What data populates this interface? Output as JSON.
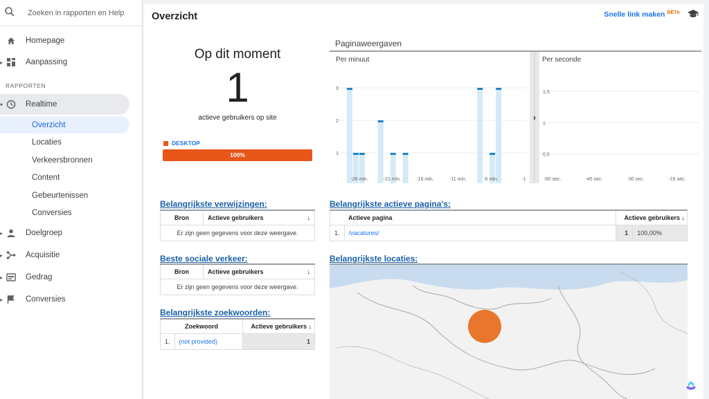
{
  "search": {
    "placeholder": "Zoeken in rapporten en Help"
  },
  "nav": {
    "home": "Homepage",
    "customization": "Aanpassing",
    "section": "RAPPORTEN",
    "realtime": "Realtime",
    "realtime_sub": [
      "Overzicht",
      "Locaties",
      "Verkeersbronnen",
      "Content",
      "Gebeurtenissen",
      "Conversies"
    ],
    "audience": "Doelgroep",
    "acquisition": "Acquisitie",
    "behavior": "Gedrag",
    "conversions": "Conversies"
  },
  "header": {
    "title": "Overzicht",
    "quicklink": "Snelle link maken",
    "beta": "BÈTA"
  },
  "now": {
    "title": "Op dit moment",
    "count": "1",
    "subtitle": "actieve gebruikers op site",
    "device_label": "DESKTOP",
    "device_percent": "100%",
    "device_fraction": 1.0
  },
  "pageviews": {
    "title": "Paginaweergaven",
    "per_minute_label": "Per minuut",
    "per_second_label": "Per seconde",
    "arrow": "›"
  },
  "chart_data": [
    {
      "type": "bar",
      "title": "Per minuut",
      "y_ticks": [
        "1",
        "2",
        "3"
      ],
      "ylim": [
        0,
        3
      ],
      "x_ticks": [
        "-26 min.",
        "-21 min.",
        "-16 min.",
        "-11 min.",
        "-6 min.",
        "-1"
      ],
      "x": [
        -30,
        -29,
        -28,
        -27,
        -26,
        -25,
        -24,
        -23,
        -22,
        -21,
        -20,
        -19,
        -18,
        -17,
        -16,
        -15,
        -14,
        -13,
        -12,
        -11,
        -10,
        -9,
        -8,
        -7,
        -6,
        -5,
        -4,
        -3,
        -2,
        -1
      ],
      "values": [
        0,
        3,
        1,
        1,
        0,
        0,
        2,
        0,
        1,
        0,
        1,
        0,
        0,
        0,
        0,
        0,
        0,
        0,
        0,
        0,
        0,
        0,
        3,
        0,
        1,
        3,
        0,
        0,
        0,
        0
      ]
    },
    {
      "type": "bar",
      "title": "Per seconde",
      "y_ticks": [
        "0,5",
        "1",
        "1,5"
      ],
      "ylim": [
        0,
        1.5
      ],
      "x_ticks": [
        "-60 sec.",
        "-45 sec.",
        "-30 sec.",
        "-15 sec."
      ],
      "values": []
    }
  ],
  "referrals": {
    "title": "Belangrijkste verwijzingen:",
    "col1": "Bron",
    "col2": "Actieve gebruikers",
    "empty": "Er zijn geen gegevens voor deze weergave."
  },
  "social": {
    "title": "Beste sociale verkeer:",
    "col1": "Bron",
    "col2": "Actieve gebruikers",
    "empty": "Er zijn geen gegevens voor deze weergave."
  },
  "keywords": {
    "title": "Belangrijkste zoekwoorden:",
    "col1": "Zoekwoord",
    "col2": "Actieve gebruikers",
    "rows": [
      {
        "index": "1.",
        "term": "(not provided)",
        "value": "1"
      }
    ]
  },
  "pages": {
    "title": "Belangrijkste actieve pagina's:",
    "col1": "Actieve pagina",
    "col2": "Actieve gebruikers",
    "rows": [
      {
        "index": "1.",
        "page": "/vacatures/",
        "value": "1",
        "percent": "100,00%"
      }
    ]
  },
  "locations": {
    "title": "Belangrijkste locaties:"
  },
  "sort_icon": "arrow-down-icon",
  "colors": {
    "accent": "#1a73e8",
    "device": "#e8561a",
    "bubble": "#e8762d",
    "bar": "#1a86c8",
    "bar_fill": "#d6eaf6"
  }
}
